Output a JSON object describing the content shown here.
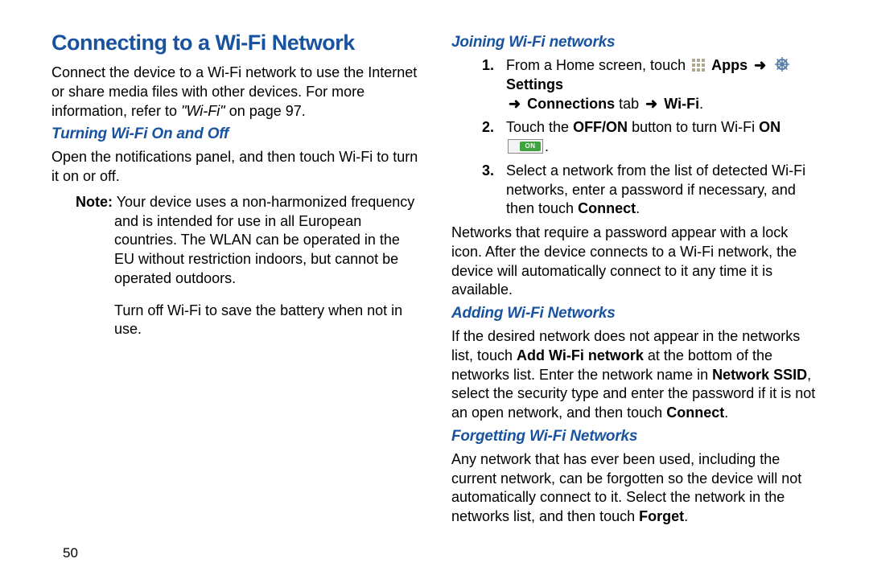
{
  "page_number": "50",
  "heading_main": "Connecting to a Wi-Fi Network",
  "col1": {
    "intro_a": "Connect the device to a Wi-Fi network to use the Internet or share media files with other devices. For more information, refer to ",
    "intro_em": "\"Wi-Fi\"",
    "intro_c": " on page 97.",
    "sub1": "Turning Wi-Fi On and Off",
    "p1": "Open the notifications panel, and then touch Wi-Fi to turn it on or off.",
    "note_label": "Note:",
    "note_body": "Your device uses a non-harmonized frequency and is intended for use in all European countries. The WLAN can be operated in the EU without restriction indoors, but cannot be operated outdoors.",
    "p2": "Turn off Wi-Fi to save the battery when not in use."
  },
  "col2": {
    "sub_join": "Joining Wi-Fi networks",
    "li1_a": "From a Home screen, touch ",
    "li1_apps": "Apps",
    "arrow": "➜",
    "li1_settings": "Settings",
    "li1_conn_a": "Connections",
    "li1_conn_b": " tab ",
    "li1_wifi": "Wi-Fi",
    "li2_a": "Touch the ",
    "li2_offon": "OFF/ON",
    "li2_b": " button to turn Wi-Fi ",
    "li2_on": "ON",
    "on_switch_label": "ON",
    "li3_a": "Select a network from the list of detected Wi-Fi networks, enter a password if necessary, and then touch ",
    "li3_connect": "Connect",
    "p_after": "Networks that require a password appear with a lock icon. After the device connects to a Wi-Fi network, the device will automatically connect to it any time it is available.",
    "sub_add": "Adding Wi-Fi Networks",
    "add_a": "If the desired network does not appear in the networks list, touch ",
    "add_b1": "Add Wi-Fi network",
    "add_c": " at the bottom of the networks list. Enter the network name in ",
    "add_b2": "Network SSID",
    "add_d": ", select the security type and enter the password if it is not an open network, and then touch ",
    "add_b3": "Connect",
    "sub_forget": "Forgetting Wi-Fi Networks",
    "forget_a": "Any network that has ever been used, including the current network, can be forgotten so the device will not automatically connect to it. Select the network in the networks list, and then touch ",
    "forget_b": "Forget"
  }
}
